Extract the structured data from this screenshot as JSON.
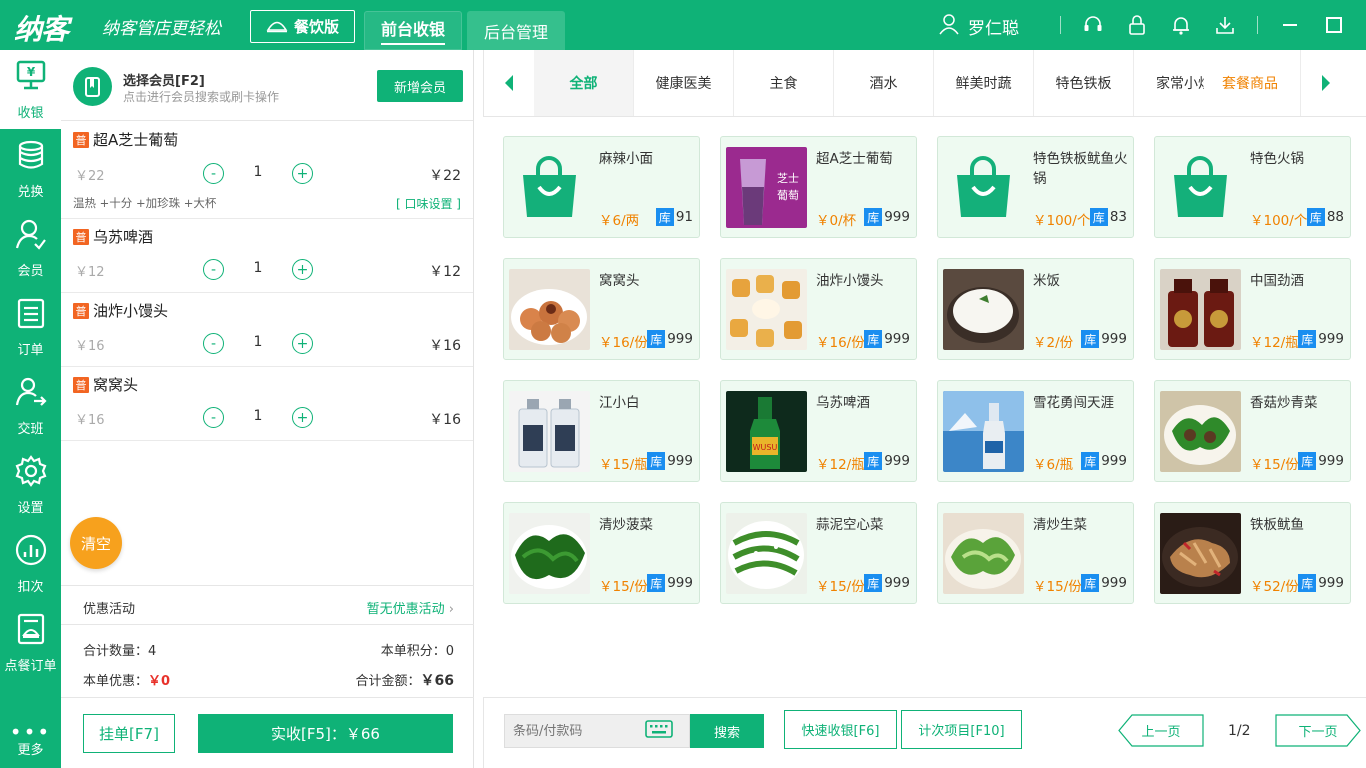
{
  "app": {
    "logo": "纳客",
    "slogan": "纳客管店更轻松",
    "edition": "餐饮版",
    "tabs": [
      {
        "label": "前台收银"
      },
      {
        "label": "后台管理"
      }
    ],
    "user": "罗仁聪"
  },
  "sidebar": {
    "items": [
      {
        "label": "收银",
        "icon": "cashier-icon"
      },
      {
        "label": "兑换",
        "icon": "coins-icon"
      },
      {
        "label": "会员",
        "icon": "member-icon"
      },
      {
        "label": "订单",
        "icon": "order-icon"
      },
      {
        "label": "交班",
        "icon": "shift-icon"
      },
      {
        "label": "设置",
        "icon": "settings-icon"
      },
      {
        "label": "扣次",
        "icon": "chart-icon"
      },
      {
        "label": "点餐订单",
        "icon": "dining-order-icon"
      }
    ],
    "more": "更多"
  },
  "member": {
    "title": "选择会员[F2]",
    "subtitle": "点击进行会员搜索或刷卡操作",
    "add_button": "新增会员"
  },
  "cart": {
    "items": [
      {
        "tag": "普",
        "name": "超A芝士葡萄",
        "price": "￥22",
        "qty": "1",
        "total": "￥22",
        "options": "温热 +十分 +加珍珠 +大杯",
        "taste": "[ 口味设置 ]"
      },
      {
        "tag": "普",
        "name": "乌苏啤酒",
        "price": "￥12",
        "qty": "1",
        "total": "￥12"
      },
      {
        "tag": "普",
        "name": "油炸小馒头",
        "price": "￥16",
        "qty": "1",
        "total": "￥16"
      },
      {
        "tag": "普",
        "name": "窝窝头",
        "price": "￥16",
        "qty": "1",
        "total": "￥16"
      }
    ],
    "minus": "-",
    "plus": "+",
    "clear": "清空"
  },
  "promo": {
    "label": "优惠活动",
    "value": "暂无优惠活动"
  },
  "summary": {
    "count_label": "合计数量：",
    "count": "4",
    "points_label": "本单积分：",
    "points": "0",
    "discount_label": "本单优惠：",
    "discount": "￥0",
    "total_label": "合计金额：",
    "total": "￥66"
  },
  "actions": {
    "hold": "挂单[F7]",
    "pay": "实收[F5]：￥66"
  },
  "categories": [
    {
      "label": "全部"
    },
    {
      "label": "健康医美"
    },
    {
      "label": "主食"
    },
    {
      "label": "酒水"
    },
    {
      "label": "鲜美时蔬"
    },
    {
      "label": "特色铁板"
    },
    {
      "label": "家常小炒"
    },
    {
      "label": "套餐商品"
    }
  ],
  "products": [
    {
      "name": "麻辣小面",
      "price": "￥6/两",
      "stock": "91",
      "img": "bag"
    },
    {
      "name": "超A芝士葡萄",
      "price": "￥0/杯",
      "stock": "999",
      "img": "drink"
    },
    {
      "name": "特色铁板鱿鱼火锅",
      "price": "￥100/个",
      "stock": "83",
      "img": "bag"
    },
    {
      "name": "特色火锅",
      "price": "￥100/个",
      "stock": "88",
      "img": "bag"
    },
    {
      "name": "窝窝头",
      "price": "￥16/份",
      "stock": "999",
      "img": "food1"
    },
    {
      "name": "油炸小馒头",
      "price": "￥16/份",
      "stock": "999",
      "img": "food2"
    },
    {
      "name": "米饭",
      "price": "￥2/份",
      "stock": "999",
      "img": "rice"
    },
    {
      "name": "中国劲酒",
      "price": "￥12/瓶",
      "stock": "999",
      "img": "liquor"
    },
    {
      "name": "江小白",
      "price": "￥15/瓶",
      "stock": "999",
      "img": "bottles"
    },
    {
      "name": "乌苏啤酒",
      "price": "￥12/瓶",
      "stock": "999",
      "img": "beer"
    },
    {
      "name": "雪花勇闯天涯",
      "price": "￥6/瓶",
      "stock": "999",
      "img": "snow"
    },
    {
      "name": "香菇炒青菜",
      "price": "￥15/份",
      "stock": "999",
      "img": "veg1"
    },
    {
      "name": "清炒菠菜",
      "price": "￥15/份",
      "stock": "999",
      "img": "veg2"
    },
    {
      "name": "蒜泥空心菜",
      "price": "￥15/份",
      "stock": "999",
      "img": "veg3"
    },
    {
      "name": "清炒生菜",
      "price": "￥15/份",
      "stock": "999",
      "img": "veg4"
    },
    {
      "name": "铁板鱿鱼",
      "price": "￥52/份",
      "stock": "999",
      "img": "squid"
    }
  ],
  "stock_label": "库",
  "footer": {
    "search_placeholder": "条码/付款码",
    "search_button": "搜索",
    "quick": "快速收银[F6]",
    "count_items": "计次项目[F10]",
    "prev": "上一页",
    "page": "1/2",
    "next": "下一页"
  },
  "colors": {
    "brand": "#0fb277",
    "price": "#f08200",
    "stock_badge": "#1a8ef0",
    "clear": "#f7a11d",
    "tag": "#f26522"
  }
}
